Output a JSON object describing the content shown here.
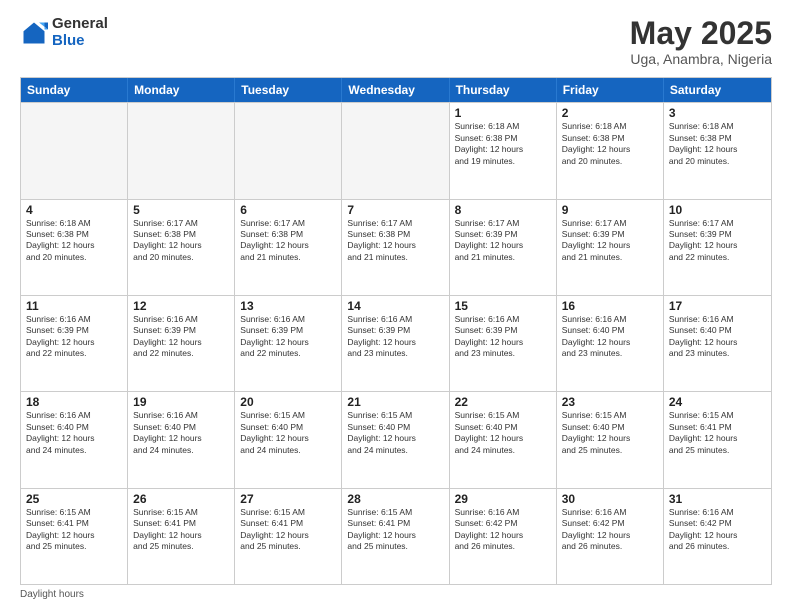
{
  "logo": {
    "general": "General",
    "blue": "Blue"
  },
  "title": "May 2025",
  "subtitle": "Uga, Anambra, Nigeria",
  "days": [
    "Sunday",
    "Monday",
    "Tuesday",
    "Wednesday",
    "Thursday",
    "Friday",
    "Saturday"
  ],
  "footer": "Daylight hours",
  "weeks": [
    [
      {
        "num": "",
        "info": "",
        "empty": true
      },
      {
        "num": "",
        "info": "",
        "empty": true
      },
      {
        "num": "",
        "info": "",
        "empty": true
      },
      {
        "num": "",
        "info": "",
        "empty": true
      },
      {
        "num": "1",
        "info": "Sunrise: 6:18 AM\nSunset: 6:38 PM\nDaylight: 12 hours\nand 19 minutes.",
        "empty": false
      },
      {
        "num": "2",
        "info": "Sunrise: 6:18 AM\nSunset: 6:38 PM\nDaylight: 12 hours\nand 20 minutes.",
        "empty": false
      },
      {
        "num": "3",
        "info": "Sunrise: 6:18 AM\nSunset: 6:38 PM\nDaylight: 12 hours\nand 20 minutes.",
        "empty": false
      }
    ],
    [
      {
        "num": "4",
        "info": "Sunrise: 6:18 AM\nSunset: 6:38 PM\nDaylight: 12 hours\nand 20 minutes.",
        "empty": false
      },
      {
        "num": "5",
        "info": "Sunrise: 6:17 AM\nSunset: 6:38 PM\nDaylight: 12 hours\nand 20 minutes.",
        "empty": false
      },
      {
        "num": "6",
        "info": "Sunrise: 6:17 AM\nSunset: 6:38 PM\nDaylight: 12 hours\nand 21 minutes.",
        "empty": false
      },
      {
        "num": "7",
        "info": "Sunrise: 6:17 AM\nSunset: 6:38 PM\nDaylight: 12 hours\nand 21 minutes.",
        "empty": false
      },
      {
        "num": "8",
        "info": "Sunrise: 6:17 AM\nSunset: 6:39 PM\nDaylight: 12 hours\nand 21 minutes.",
        "empty": false
      },
      {
        "num": "9",
        "info": "Sunrise: 6:17 AM\nSunset: 6:39 PM\nDaylight: 12 hours\nand 21 minutes.",
        "empty": false
      },
      {
        "num": "10",
        "info": "Sunrise: 6:17 AM\nSunset: 6:39 PM\nDaylight: 12 hours\nand 22 minutes.",
        "empty": false
      }
    ],
    [
      {
        "num": "11",
        "info": "Sunrise: 6:16 AM\nSunset: 6:39 PM\nDaylight: 12 hours\nand 22 minutes.",
        "empty": false
      },
      {
        "num": "12",
        "info": "Sunrise: 6:16 AM\nSunset: 6:39 PM\nDaylight: 12 hours\nand 22 minutes.",
        "empty": false
      },
      {
        "num": "13",
        "info": "Sunrise: 6:16 AM\nSunset: 6:39 PM\nDaylight: 12 hours\nand 22 minutes.",
        "empty": false
      },
      {
        "num": "14",
        "info": "Sunrise: 6:16 AM\nSunset: 6:39 PM\nDaylight: 12 hours\nand 23 minutes.",
        "empty": false
      },
      {
        "num": "15",
        "info": "Sunrise: 6:16 AM\nSunset: 6:39 PM\nDaylight: 12 hours\nand 23 minutes.",
        "empty": false
      },
      {
        "num": "16",
        "info": "Sunrise: 6:16 AM\nSunset: 6:40 PM\nDaylight: 12 hours\nand 23 minutes.",
        "empty": false
      },
      {
        "num": "17",
        "info": "Sunrise: 6:16 AM\nSunset: 6:40 PM\nDaylight: 12 hours\nand 23 minutes.",
        "empty": false
      }
    ],
    [
      {
        "num": "18",
        "info": "Sunrise: 6:16 AM\nSunset: 6:40 PM\nDaylight: 12 hours\nand 24 minutes.",
        "empty": false
      },
      {
        "num": "19",
        "info": "Sunrise: 6:16 AM\nSunset: 6:40 PM\nDaylight: 12 hours\nand 24 minutes.",
        "empty": false
      },
      {
        "num": "20",
        "info": "Sunrise: 6:15 AM\nSunset: 6:40 PM\nDaylight: 12 hours\nand 24 minutes.",
        "empty": false
      },
      {
        "num": "21",
        "info": "Sunrise: 6:15 AM\nSunset: 6:40 PM\nDaylight: 12 hours\nand 24 minutes.",
        "empty": false
      },
      {
        "num": "22",
        "info": "Sunrise: 6:15 AM\nSunset: 6:40 PM\nDaylight: 12 hours\nand 24 minutes.",
        "empty": false
      },
      {
        "num": "23",
        "info": "Sunrise: 6:15 AM\nSunset: 6:40 PM\nDaylight: 12 hours\nand 25 minutes.",
        "empty": false
      },
      {
        "num": "24",
        "info": "Sunrise: 6:15 AM\nSunset: 6:41 PM\nDaylight: 12 hours\nand 25 minutes.",
        "empty": false
      }
    ],
    [
      {
        "num": "25",
        "info": "Sunrise: 6:15 AM\nSunset: 6:41 PM\nDaylight: 12 hours\nand 25 minutes.",
        "empty": false
      },
      {
        "num": "26",
        "info": "Sunrise: 6:15 AM\nSunset: 6:41 PM\nDaylight: 12 hours\nand 25 minutes.",
        "empty": false
      },
      {
        "num": "27",
        "info": "Sunrise: 6:15 AM\nSunset: 6:41 PM\nDaylight: 12 hours\nand 25 minutes.",
        "empty": false
      },
      {
        "num": "28",
        "info": "Sunrise: 6:15 AM\nSunset: 6:41 PM\nDaylight: 12 hours\nand 25 minutes.",
        "empty": false
      },
      {
        "num": "29",
        "info": "Sunrise: 6:16 AM\nSunset: 6:42 PM\nDaylight: 12 hours\nand 26 minutes.",
        "empty": false
      },
      {
        "num": "30",
        "info": "Sunrise: 6:16 AM\nSunset: 6:42 PM\nDaylight: 12 hours\nand 26 minutes.",
        "empty": false
      },
      {
        "num": "31",
        "info": "Sunrise: 6:16 AM\nSunset: 6:42 PM\nDaylight: 12 hours\nand 26 minutes.",
        "empty": false
      }
    ]
  ]
}
